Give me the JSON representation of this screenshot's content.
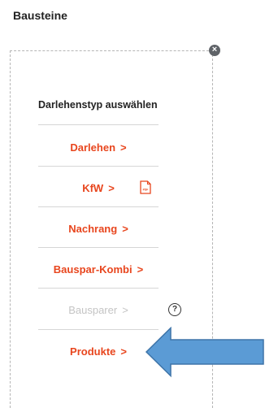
{
  "header": {
    "title": "Bausteine"
  },
  "card": {
    "close_glyph": "×",
    "list_title": "Darlehenstyp auswählen",
    "items": [
      {
        "label": "Darlehen",
        "chevron": ">",
        "enabled": true
      },
      {
        "label": "KfW",
        "chevron": ">",
        "enabled": true,
        "icon": "pdf-icon"
      },
      {
        "label": "Nachrang",
        "chevron": ">",
        "enabled": true
      },
      {
        "label": "Bauspar-Kombi",
        "chevron": ">",
        "enabled": true
      },
      {
        "label": "Bausparer",
        "chevron": ">",
        "enabled": false,
        "icon": "help-icon"
      },
      {
        "label": "Produkte",
        "chevron": ">",
        "enabled": true
      }
    ],
    "pdf_icon_text": "PDF",
    "help_glyph": "?"
  },
  "colors": {
    "accent": "#e8461e",
    "disabled": "#c4c4c4",
    "annotation_arrow": "#5b9bd5"
  }
}
